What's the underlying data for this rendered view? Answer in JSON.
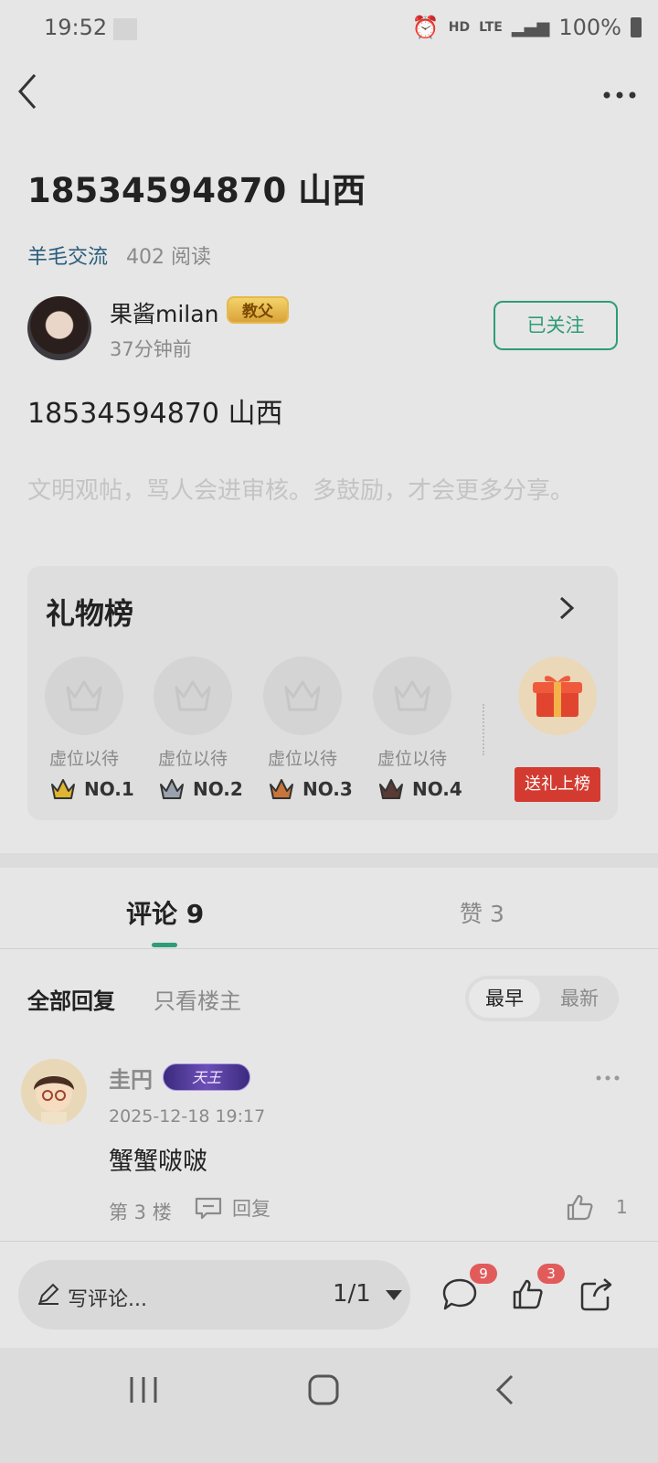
{
  "status_bar": {
    "time": "19:52",
    "network": "HD",
    "signal_type": "LTE",
    "battery": "100%"
  },
  "post": {
    "title": "18534594870 山西",
    "category": "羊毛交流",
    "reads": "402 阅读",
    "author": {
      "name": "果酱milan",
      "badge": "教父",
      "time": "37分钟前"
    },
    "follow_label": "已关注",
    "content": "18534594870  山西",
    "notice": "文明观帖，骂人会进审核。多鼓励，才会更多分享。"
  },
  "gift_board": {
    "title": "礼物榜",
    "slots": [
      {
        "label": "虚位以待",
        "rank": "NO.1",
        "color": "#e0b431"
      },
      {
        "label": "虚位以待",
        "rank": "NO.2",
        "color": "#9aa3ad"
      },
      {
        "label": "虚位以待",
        "rank": "NO.3",
        "color": "#c8743a"
      },
      {
        "label": "虚位以待",
        "rank": "NO.4",
        "color": "#5a3a34"
      }
    ],
    "send_label": "送礼上榜"
  },
  "tabs": {
    "comments": "评论 9",
    "likes": "赞 3"
  },
  "filters": {
    "all": "全部回复",
    "owner_only": "只看楼主",
    "earliest": "最早",
    "newest": "最新"
  },
  "comments": [
    {
      "name": "圭円",
      "badge": "天王",
      "date": "2025-12-18 19:17",
      "text": "蟹蟹啵啵",
      "floor": "第 3 楼",
      "reply_label": "回复",
      "likes": "1"
    }
  ],
  "bottom_bar": {
    "write_placeholder": "写评论...",
    "page": "1/1",
    "comment_count": "9",
    "like_count": "3"
  },
  "colors": {
    "accent": "#2e9c78",
    "gift_red": "#d33b30",
    "category_blue": "#2b5d7d"
  }
}
